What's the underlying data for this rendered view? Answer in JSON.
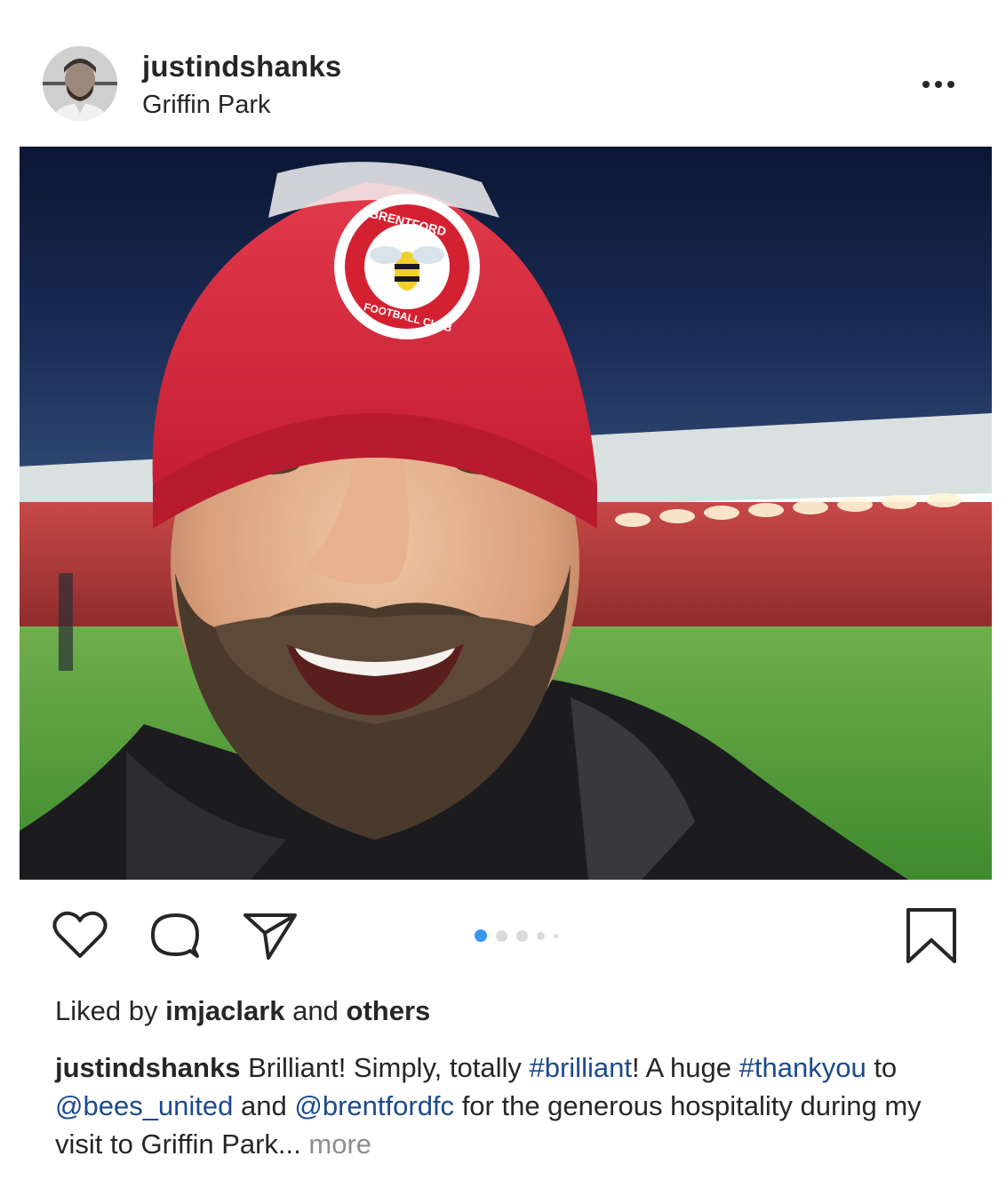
{
  "post": {
    "username": "justindshanks",
    "location": "Griffin Park",
    "icons": {
      "avatar": "avatar",
      "more": "more-options-icon",
      "like": "heart-icon",
      "comment": "comment-icon",
      "share": "send-icon",
      "save": "bookmark-icon"
    },
    "carousel": {
      "total": 5,
      "active_index": 0,
      "active_color": "#3897f0"
    },
    "likes": {
      "prefix": "Liked by",
      "user": "imjaclark",
      "middle": "and",
      "suffix": "others"
    },
    "caption": {
      "username": "justindshanks",
      "t1": "Brilliant! Simply, totally",
      "h1": "#brilliant",
      "t2": "! A huge",
      "h2": "#thankyou",
      "t3": "to",
      "m1": "@bees_united",
      "t4": "and",
      "m2": "@brentfordfc",
      "t5": "for the generous hospitality during my visit to Griffin Park...",
      "more": "more"
    },
    "hat_badge": {
      "top": "BRENTFORD",
      "bottom": "FOOTBALL CLUB"
    },
    "colors": {
      "hashtag": "#1c4a8c",
      "muted": "#8e8e8e",
      "hat_red": "#d8283a",
      "pitch_green": "#4f9b3a",
      "sky": "#0d1a3a"
    }
  }
}
